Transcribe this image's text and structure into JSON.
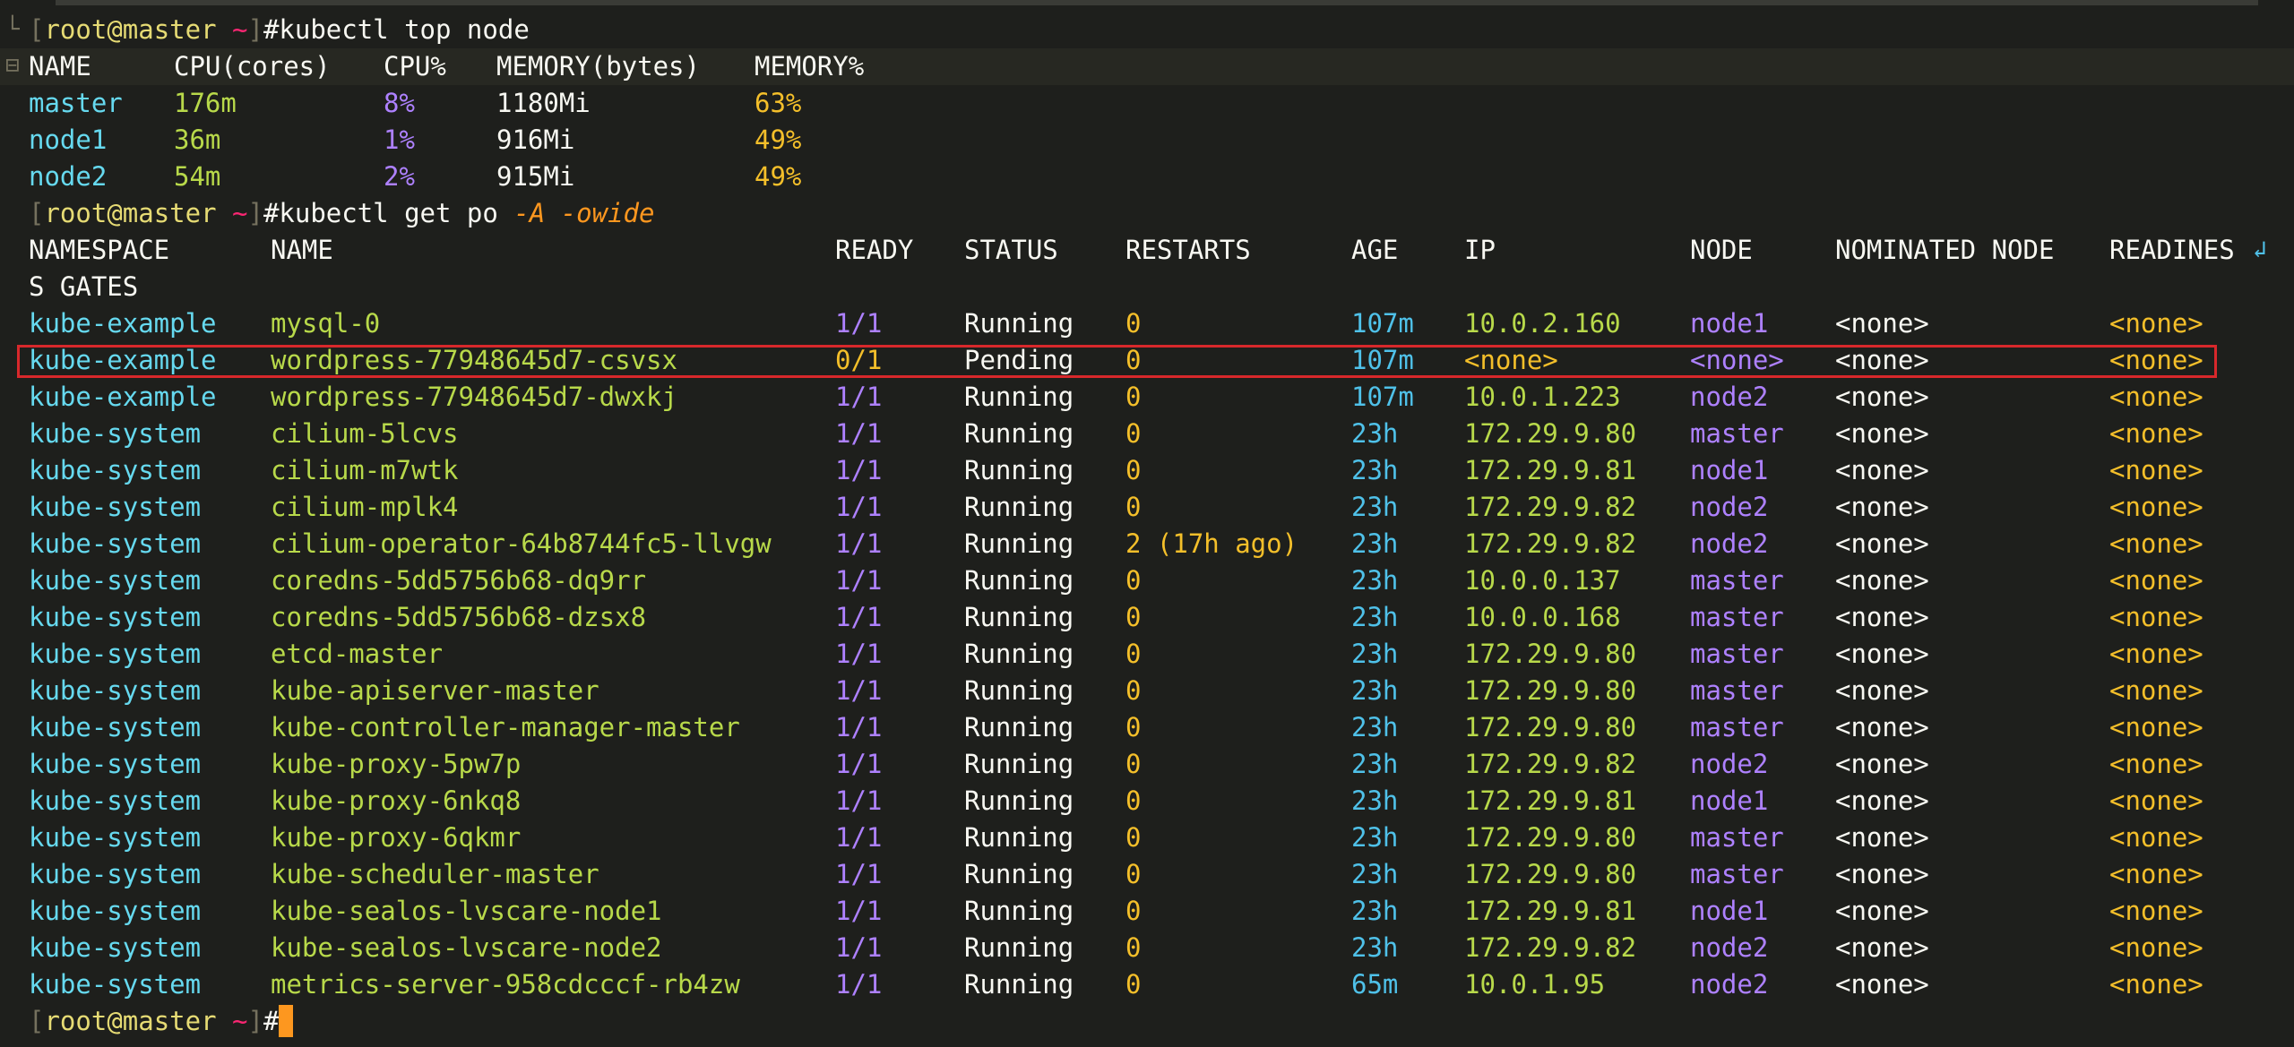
{
  "prompt": {
    "open": "[",
    "user": "root",
    "at": "@",
    "host": "master",
    "tilde": "~",
    "close": "]",
    "hash": "#"
  },
  "commands": {
    "top_node": "kubectl top node",
    "get_po_base": "kubectl get po ",
    "get_po_flags": "-A -owide"
  },
  "top_node": {
    "headers": [
      "NAME",
      "CPU(cores)",
      "CPU%",
      "MEMORY(bytes)",
      "MEMORY%"
    ],
    "rows": [
      [
        "master",
        "176m",
        "8%",
        "1180Mi",
        "63%"
      ],
      [
        "node1",
        "36m",
        "1%",
        "916Mi",
        "49%"
      ],
      [
        "node2",
        "54m",
        "2%",
        "915Mi",
        "49%"
      ]
    ]
  },
  "pods": {
    "headers": [
      "NAMESPACE",
      "NAME",
      "READY",
      "STATUS",
      "RESTARTS",
      "AGE",
      "IP",
      "NODE",
      "NOMINATED NODE",
      "READINES"
    ],
    "header_wrap": "S GATES",
    "rows": [
      [
        "kube-example",
        "mysql-0",
        "1/1",
        "Running",
        "0",
        "107m",
        "10.0.2.160",
        "node1",
        "<none>",
        "<none>"
      ],
      [
        "kube-example",
        "wordpress-77948645d7-csvsx",
        "0/1",
        "Pending",
        "0",
        "107m",
        "<none>",
        "<none>",
        "<none>",
        "<none>"
      ],
      [
        "kube-example",
        "wordpress-77948645d7-dwxkj",
        "1/1",
        "Running",
        "0",
        "107m",
        "10.0.1.223",
        "node2",
        "<none>",
        "<none>"
      ],
      [
        "kube-system",
        "cilium-5lcvs",
        "1/1",
        "Running",
        "0",
        "23h",
        "172.29.9.80",
        "master",
        "<none>",
        "<none>"
      ],
      [
        "kube-system",
        "cilium-m7wtk",
        "1/1",
        "Running",
        "0",
        "23h",
        "172.29.9.81",
        "node1",
        "<none>",
        "<none>"
      ],
      [
        "kube-system",
        "cilium-mplk4",
        "1/1",
        "Running",
        "0",
        "23h",
        "172.29.9.82",
        "node2",
        "<none>",
        "<none>"
      ],
      [
        "kube-system",
        "cilium-operator-64b8744fc5-llvgw",
        "1/1",
        "Running",
        "2 (17h ago)",
        "23h",
        "172.29.9.82",
        "node2",
        "<none>",
        "<none>"
      ],
      [
        "kube-system",
        "coredns-5dd5756b68-dq9rr",
        "1/1",
        "Running",
        "0",
        "23h",
        "10.0.0.137",
        "master",
        "<none>",
        "<none>"
      ],
      [
        "kube-system",
        "coredns-5dd5756b68-dzsx8",
        "1/1",
        "Running",
        "0",
        "23h",
        "10.0.0.168",
        "master",
        "<none>",
        "<none>"
      ],
      [
        "kube-system",
        "etcd-master",
        "1/1",
        "Running",
        "0",
        "23h",
        "172.29.9.80",
        "master",
        "<none>",
        "<none>"
      ],
      [
        "kube-system",
        "kube-apiserver-master",
        "1/1",
        "Running",
        "0",
        "23h",
        "172.29.9.80",
        "master",
        "<none>",
        "<none>"
      ],
      [
        "kube-system",
        "kube-controller-manager-master",
        "1/1",
        "Running",
        "0",
        "23h",
        "172.29.9.80",
        "master",
        "<none>",
        "<none>"
      ],
      [
        "kube-system",
        "kube-proxy-5pw7p",
        "1/1",
        "Running",
        "0",
        "23h",
        "172.29.9.82",
        "node2",
        "<none>",
        "<none>"
      ],
      [
        "kube-system",
        "kube-proxy-6nkq8",
        "1/1",
        "Running",
        "0",
        "23h",
        "172.29.9.81",
        "node1",
        "<none>",
        "<none>"
      ],
      [
        "kube-system",
        "kube-proxy-6qkmr",
        "1/1",
        "Running",
        "0",
        "23h",
        "172.29.9.80",
        "master",
        "<none>",
        "<none>"
      ],
      [
        "kube-system",
        "kube-scheduler-master",
        "1/1",
        "Running",
        "0",
        "23h",
        "172.29.9.80",
        "master",
        "<none>",
        "<none>"
      ],
      [
        "kube-system",
        "kube-sealos-lvscare-node1",
        "1/1",
        "Running",
        "0",
        "23h",
        "172.29.9.81",
        "node1",
        "<none>",
        "<none>"
      ],
      [
        "kube-system",
        "kube-sealos-lvscare-node2",
        "1/1",
        "Running",
        "0",
        "23h",
        "172.29.9.82",
        "node2",
        "<none>",
        "<none>"
      ],
      [
        "kube-system",
        "metrics-server-958cdcccf-rb4zw",
        "1/1",
        "Running",
        "0",
        "65m",
        "10.0.1.95",
        "node2",
        "<none>",
        "<none>"
      ]
    ]
  },
  "icons": {
    "wrap": "wrap-arrow-icon",
    "fold": "fold-minus-icon"
  },
  "colors": {
    "background": "#1e1f1c",
    "highlight_border": "#d8282b",
    "cursor": "#fd971f"
  }
}
